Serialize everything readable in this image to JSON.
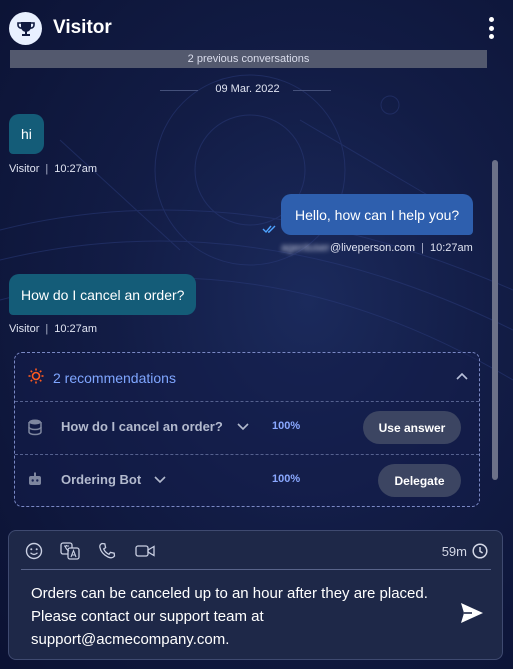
{
  "header": {
    "title": "Visitor",
    "avatar_icon": "trophy-icon",
    "menu_icon": "kebab-menu-icon"
  },
  "history": {
    "previous_conversations": "2 previous conversations",
    "date": "09 Mar. 2022"
  },
  "messages": [
    {
      "sender": "visitor",
      "text": "hi",
      "author": "Visitor",
      "time": "10:27am"
    },
    {
      "sender": "agent",
      "text": "Hello, how can I help you?",
      "author_hidden": "agentuser",
      "author_domain": "@liveperson.com",
      "time": "10:27am",
      "read_icon": "double-check-icon"
    },
    {
      "sender": "visitor",
      "text": "How do I cancel an order?",
      "author": "Visitor",
      "time": "10:27am"
    }
  ],
  "recommendations": {
    "title": "2 recommendations",
    "icon": "sun-icon",
    "items": [
      {
        "label": "How do I cancel an order?",
        "icon": "database-icon",
        "confidence": "100%",
        "action": "Use answer"
      },
      {
        "label": "Ordering Bot",
        "icon": "bot-icon",
        "confidence": "100%",
        "action": "Delegate"
      }
    ]
  },
  "composer": {
    "timer": "59m",
    "text": "Orders can be canceled up to an hour after they are placed. Please contact our support team at support@acmecompany.com.",
    "tools": [
      "emoji-icon",
      "translate-icon",
      "phone-icon",
      "video-icon"
    ]
  },
  "colors": {
    "background": "#121c45",
    "visitor_bubble": "#145c78",
    "agent_bubble": "#2e5fae",
    "accent": "#7fa6ff",
    "recommendation_sun": "#ff5a1f"
  }
}
